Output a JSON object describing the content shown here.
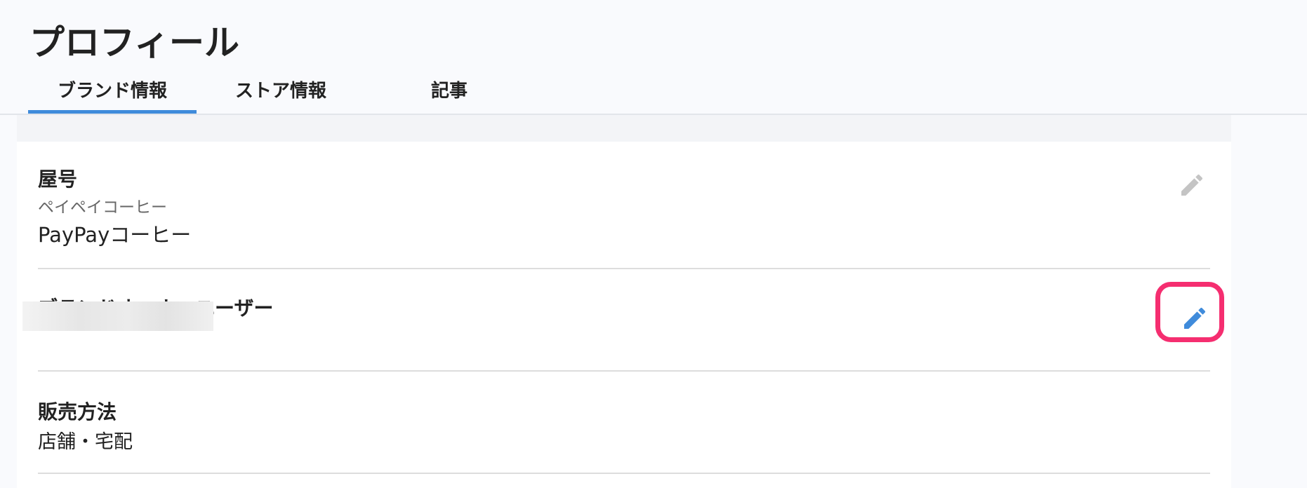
{
  "page": {
    "title": "プロフィール"
  },
  "tabs": [
    {
      "label": "ブランド情報",
      "active": true
    },
    {
      "label": "ストア情報",
      "active": false
    },
    {
      "label": "記事",
      "active": false
    }
  ],
  "sections": {
    "store_name": {
      "label": "屋号",
      "kana": "ペイペイコーヒー",
      "value": "PayPayコーヒー",
      "edit_icon": "pencil-icon",
      "icon_color": "#c4c4c4"
    },
    "brand_owner": {
      "label": "ブランドオーナーユーザー",
      "edit_icon": "pencil-icon",
      "icon_color": "#3f8bdb",
      "highlight_color": "#f52e70"
    },
    "sales_method": {
      "label": "販売方法",
      "value": "店舗・宅配"
    }
  },
  "colors": {
    "accent": "#3f8bdb",
    "highlight": "#f52e70"
  }
}
